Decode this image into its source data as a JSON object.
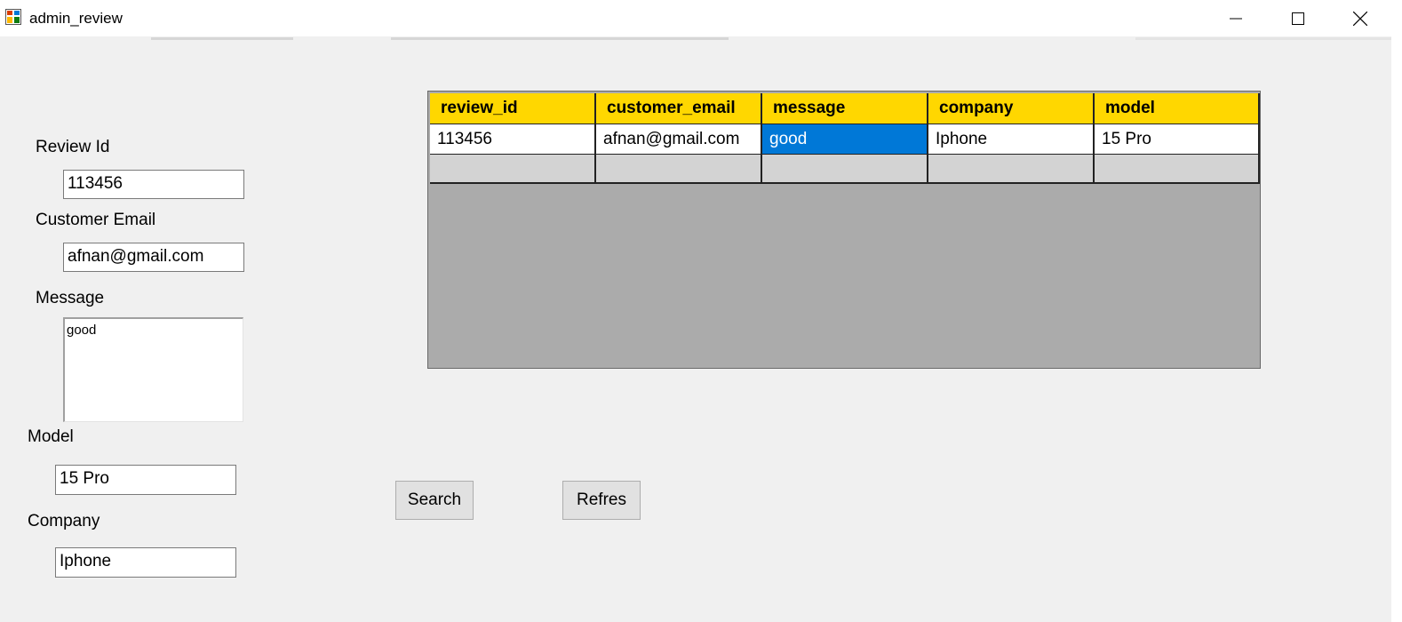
{
  "window": {
    "title": "admin_review",
    "controls": [
      "minimize-icon",
      "maximize-icon",
      "close-icon"
    ]
  },
  "form": {
    "review_id_label": "Review Id",
    "review_id_value": "113456",
    "customer_email_label": "Customer Email",
    "customer_email_value": "afnan@gmail.com",
    "message_label": "Message",
    "message_value": "good",
    "model_label": "Model",
    "model_value": "15 Pro",
    "company_label": "Company",
    "company_value": "Iphone"
  },
  "buttons": {
    "search": "Search",
    "refresh": "Refres"
  },
  "grid": {
    "columns": [
      "review_id",
      "customer_email",
      "message",
      "company",
      "model"
    ],
    "rows": [
      [
        "113456",
        "afnan@gmail.com",
        "good",
        "Iphone",
        "15 Pro"
      ]
    ],
    "selected_cell": "message",
    "colors": {
      "header_bg": "#ffd700",
      "selection_bg": "#0078d7",
      "empty_area": "#ababab",
      "new_row_bg": "#d3d3d3"
    }
  }
}
